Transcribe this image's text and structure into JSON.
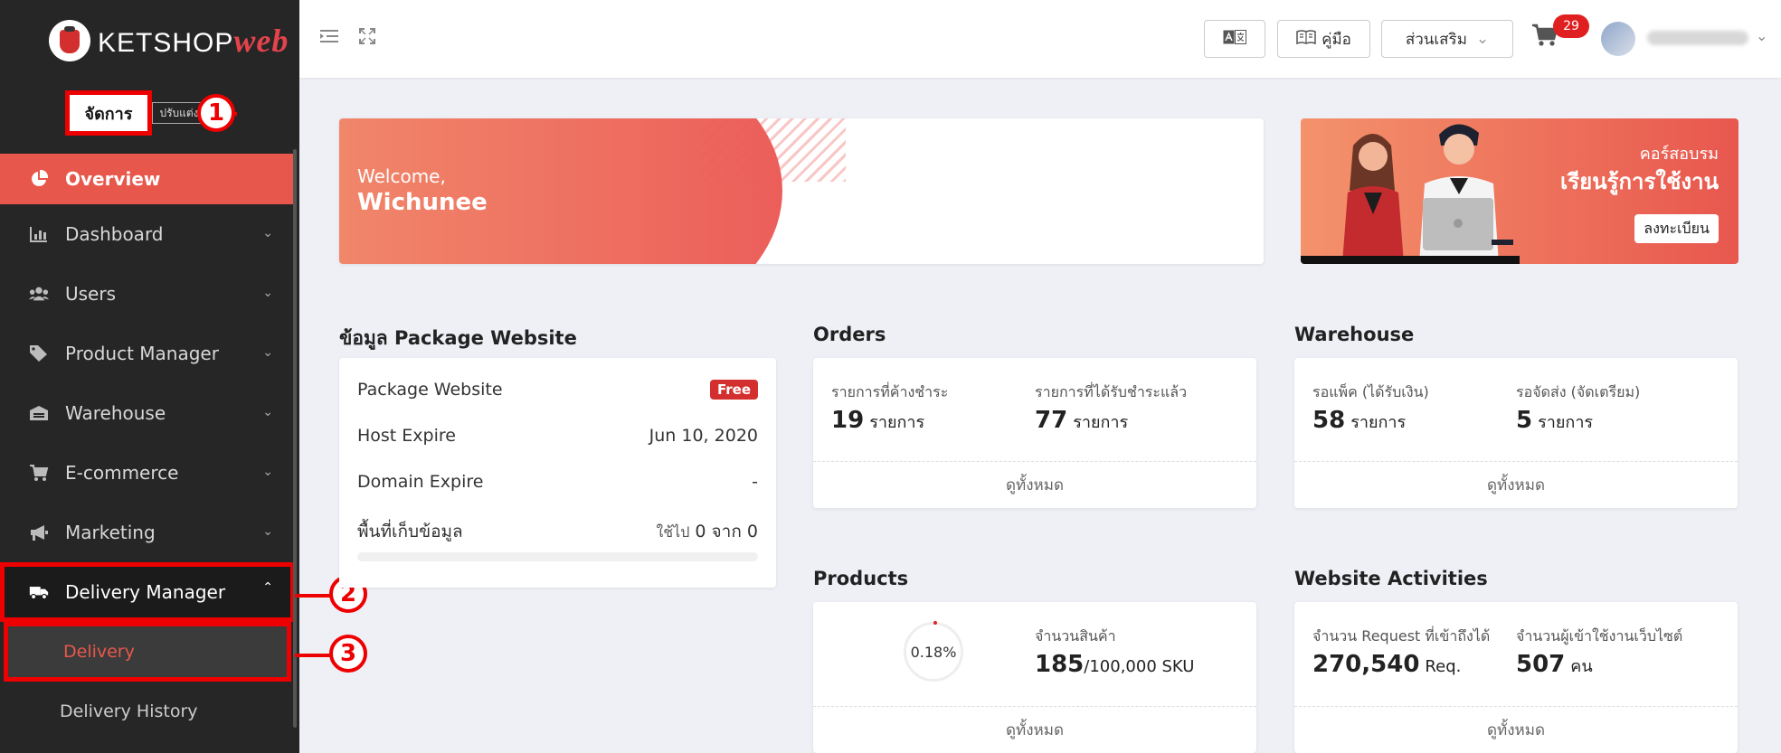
{
  "brand": {
    "name": "KETSHOP",
    "suffix": "web"
  },
  "sidebar": {
    "manage_tab": "จัดการ",
    "second_tab": "ปรับแต่ง",
    "callouts": [
      "1",
      "2",
      "3"
    ],
    "items": [
      {
        "label": "Overview",
        "icon": "pie-chart-icon"
      },
      {
        "label": "Dashboard",
        "icon": "bar-chart-icon"
      },
      {
        "label": "Users",
        "icon": "users-icon"
      },
      {
        "label": "Product Manager",
        "icon": "tag-icon"
      },
      {
        "label": "Warehouse",
        "icon": "warehouse-icon"
      },
      {
        "label": "E-commerce",
        "icon": "cart-icon"
      },
      {
        "label": "Marketing",
        "icon": "megaphone-icon"
      },
      {
        "label": "Delivery Manager",
        "icon": "truck-icon"
      }
    ],
    "sub_items": [
      {
        "label": "Delivery"
      },
      {
        "label": "Delivery History"
      }
    ]
  },
  "header": {
    "manual_label": "คู่มือ",
    "addons_label": "ส่วนเสริม",
    "cart_count": "29"
  },
  "welcome": {
    "greeting": "Welcome,",
    "name": "Wichunee"
  },
  "course": {
    "line1": "คอร์สอบรม",
    "line2": "เรียนรู้การใช้งาน",
    "button": "ลงทะเบียน"
  },
  "package": {
    "title": "ข้อมูล Package Website",
    "rows": [
      {
        "label": "Package Website",
        "value": "Free"
      },
      {
        "label": "Host Expire",
        "value": "Jun 10, 2020"
      },
      {
        "label": "Domain Expire",
        "value": "-"
      },
      {
        "label": "พื้นที่เก็บข้อมูล",
        "value_prefix": "ใช้ไป",
        "used": "0",
        "value_mid": "จาก",
        "total": "0"
      }
    ]
  },
  "orders": {
    "title": "Orders",
    "left": {
      "label": "รายการที่ค้างชำระ",
      "value": "19",
      "unit": "รายการ"
    },
    "right": {
      "label": "รายการที่ได้รับชำระแล้ว",
      "value": "77",
      "unit": "รายการ"
    },
    "footer": "ดูทั้งหมด"
  },
  "warehouse": {
    "title": "Warehouse",
    "left": {
      "label": "รอแพ็ค (ได้รับเงิน)",
      "value": "58",
      "unit": "รายการ"
    },
    "right": {
      "label": "รอจัดส่ง (จัดเตรียม)",
      "value": "5",
      "unit": "รายการ"
    },
    "footer": "ดูทั้งหมด"
  },
  "products": {
    "title": "Products",
    "percent": "0.18%",
    "label": "จำนวนสินค้า",
    "value": "185",
    "limit": "/100,000 SKU",
    "footer": "ดูทั้งหมด"
  },
  "activities": {
    "title": "Website Activities",
    "left": {
      "label": "จำนวน Request ที่เข้าถึงได้",
      "value": "270,540",
      "unit": "Req."
    },
    "right": {
      "label": "จำนวนผู้เข้าใช้งานเว็บไซต์",
      "value": "507",
      "unit": "คน"
    },
    "footer": "ดูทั้งหมด"
  },
  "colors": {
    "accent": "#e8574b",
    "sidebar": "#262626",
    "callout": "#ee0000"
  }
}
